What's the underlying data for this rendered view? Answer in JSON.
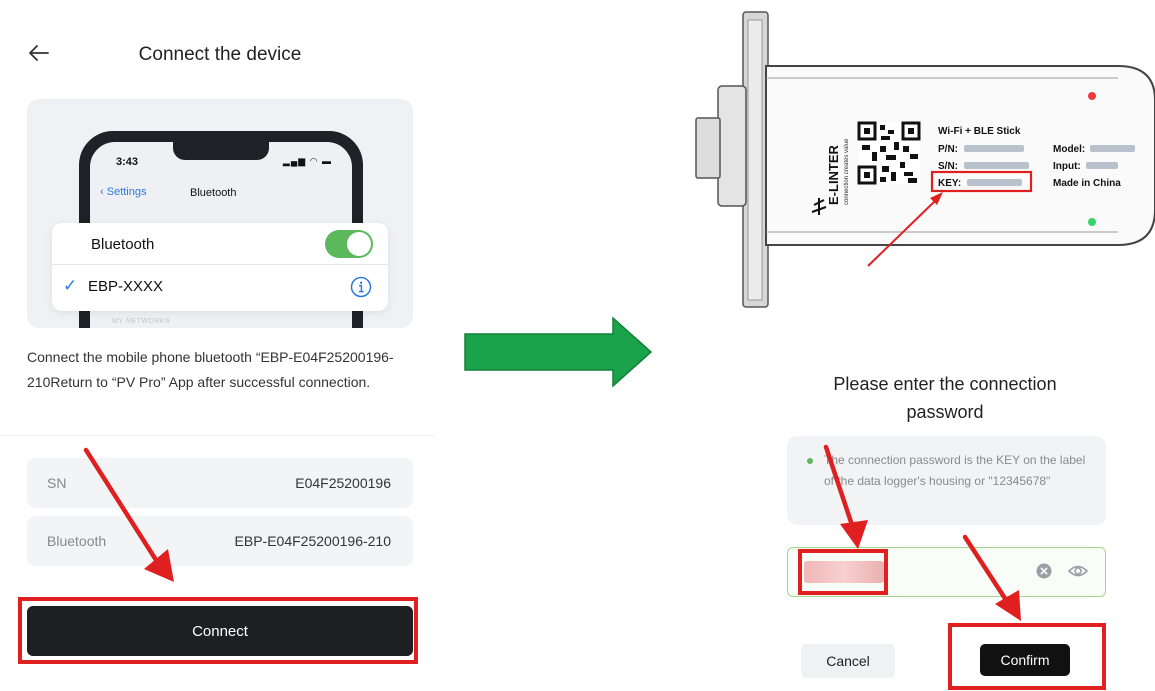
{
  "left": {
    "title": "Connect the device",
    "phone_illustration": {
      "time": "3:43",
      "status_icons": "▂▄▆ ◠ ▬",
      "settings_back_label": "Settings",
      "nav_title": "Bluetooth",
      "bluetooth_label": "Bluetooth",
      "toggle_on": true,
      "device_name": "EBP-XXXX",
      "section_caption": "MY NETWORKS"
    },
    "instructions": "Connect the mobile phone bluetooth “EBP-E04F25200196-210Return to “PV Pro” App after successful connection.",
    "rows": [
      {
        "label": "SN",
        "value": "E04F25200196"
      },
      {
        "label": "Bluetooth",
        "value": "EBP-E04F25200196-210"
      }
    ],
    "connect_label": "Connect"
  },
  "logger_label": {
    "brand": "E-LINTER",
    "tagline": "connection creates value",
    "product": "Wi-Fi + BLE Stick",
    "pn_label": "P/N:",
    "sn_label": "S/N:",
    "key_label": "KEY:",
    "model_label": "Model:",
    "input_label": "Input:",
    "made_in": "Made in China"
  },
  "right": {
    "password_title": "Please enter the connection password",
    "hint": "The connection password is the KEY on the label of the data logger's housing or \"12345678\"",
    "password_value": "********",
    "cancel_label": "Cancel",
    "confirm_label": "Confirm"
  },
  "colors": {
    "highlight": "#e02020",
    "arrow_green": "#1aa34a",
    "toggle_green": "#5cb85c",
    "button_dark": "#1e1f22"
  }
}
